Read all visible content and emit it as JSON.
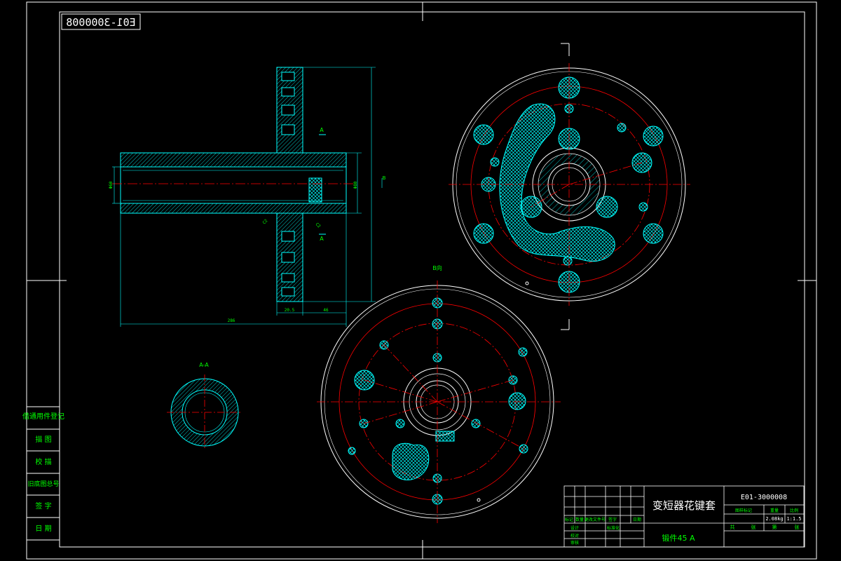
{
  "drawing": {
    "number_mirrored": "E01-3000008",
    "title": "变短器花键套",
    "number": "E01-3000008",
    "material": "锻件45 A",
    "weight": "2.08kg",
    "scale": "1:1.5",
    "colors": {
      "background": "#000000",
      "frame": "#ffffff",
      "outline": "#00ffff",
      "centerline": "#ff0000",
      "text": "#00ff00",
      "hatch": "#00ffff"
    }
  },
  "views": {
    "section_label_a": "A",
    "section_label_a2": "A",
    "section_label_b": "B",
    "section_view_title": "A-A",
    "view_b_title": "B向"
  },
  "dimensions": {
    "overall_length": "286",
    "flange_thickness": "20.5",
    "flange_offset": "46",
    "bore_diameter": "Φ60",
    "hub_diameter": "Φ80"
  },
  "left_table": {
    "rows": [
      "借通用件登记",
      "描 图",
      "校 描",
      "旧底图总号",
      "签 字",
      "日 期"
    ]
  },
  "title_block": {
    "header_cells": [
      "标记",
      "数量",
      "更改文件号",
      "签字",
      "日期"
    ],
    "role_rows": [
      "设计",
      "校对",
      "审核",
      "工艺"
    ],
    "role_right": [
      "标准化",
      "",
      "",
      ""
    ],
    "info_headers": [
      "图样标记",
      "重量",
      "比例"
    ],
    "sheet_labels": [
      "共",
      "张",
      "第",
      "张"
    ]
  }
}
